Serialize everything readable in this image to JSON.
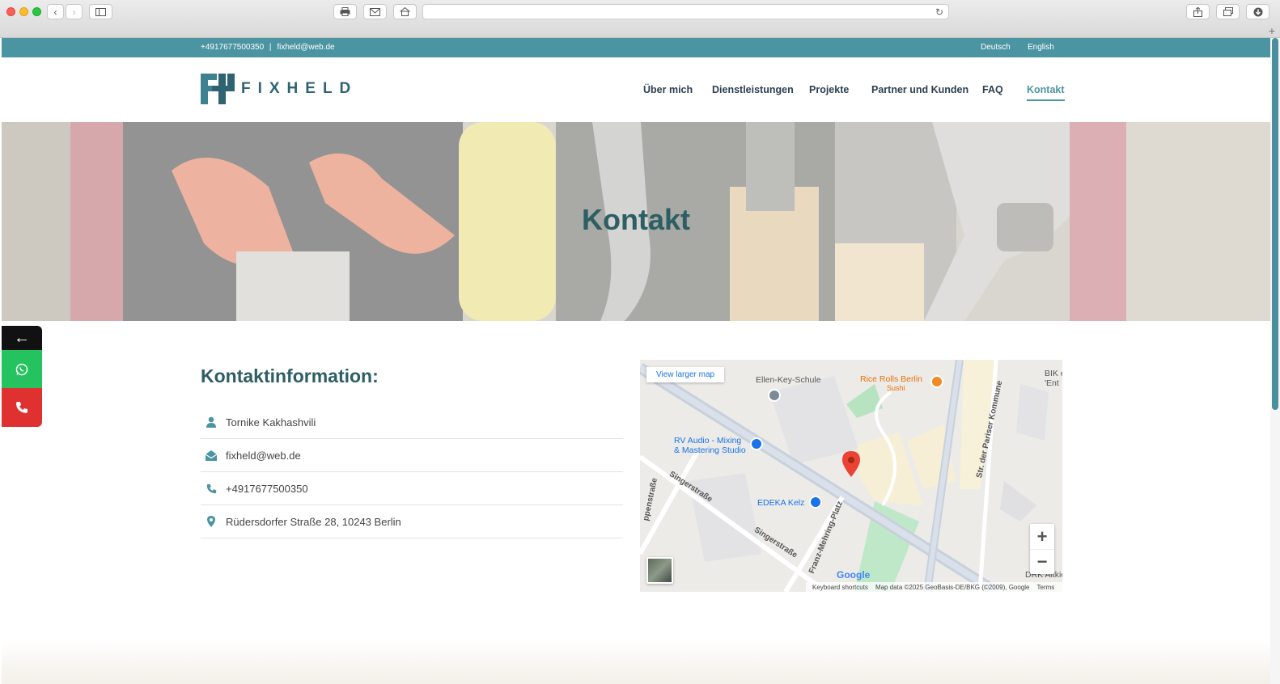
{
  "browser": {
    "url": ""
  },
  "topbar": {
    "phone": "+4917677500350",
    "separator": "|",
    "email": "fixheld@web.de",
    "languages": [
      "Deutsch",
      "English"
    ]
  },
  "header": {
    "logo_text": "FIXHELD",
    "nav": [
      {
        "label": "Über mich",
        "active": false
      },
      {
        "label": "Dienstleistungen",
        "active": false
      },
      {
        "label": "Projekte",
        "active": false
      },
      {
        "label": "Partner und Kunden",
        "active": false
      },
      {
        "label": "FAQ",
        "active": false
      },
      {
        "label": "Kontakt",
        "active": true
      }
    ]
  },
  "hero": {
    "title": "Kontakt"
  },
  "side_buttons": {
    "back_icon": "←"
  },
  "contact_info": {
    "title": "Kontaktinformation:",
    "items": [
      {
        "icon": "person-icon",
        "text": "Tornike Kakhashvili"
      },
      {
        "icon": "mail-icon",
        "text": "fixheld@web.de"
      },
      {
        "icon": "phone-icon",
        "text": "+4917677500350"
      },
      {
        "icon": "location-pin-icon",
        "text": "Rüdersdorfer Straße 28, 10243 Berlin"
      }
    ]
  },
  "map": {
    "view_larger": "View larger map",
    "places": {
      "school": "Ellen-Key-Schule",
      "restaurant": "Rice Rolls Berlin",
      "restaurant_sub": "Sushi",
      "studio_line1": "RV Audio - Mixing",
      "studio_line2": "& Mastering Studio",
      "market": "EDEKA Kelz",
      "bik1": "BIK e",
      "bik2": "'Ent",
      "drk": "DRK Altkiez",
      "street_pariser": "Str. der Pariser Kommune",
      "street_singer1": "Singerstraße",
      "street_singer2": "Singerstraße",
      "street_franz": "Franz-Mehring-Platz",
      "street_left": "ppenstraße"
    },
    "zoom_in": "+",
    "zoom_out": "−",
    "google": "Google",
    "footer": {
      "shortcuts": "Keyboard shortcuts",
      "attribution": "Map data ©2025 GeoBasis-DE/BKG (©2009), Google",
      "terms": "Terms"
    }
  },
  "colors": {
    "teal": "#4b94a1",
    "dark_teal": "#2d5e63",
    "whatsapp": "#25c35f",
    "call": "#e03131"
  }
}
